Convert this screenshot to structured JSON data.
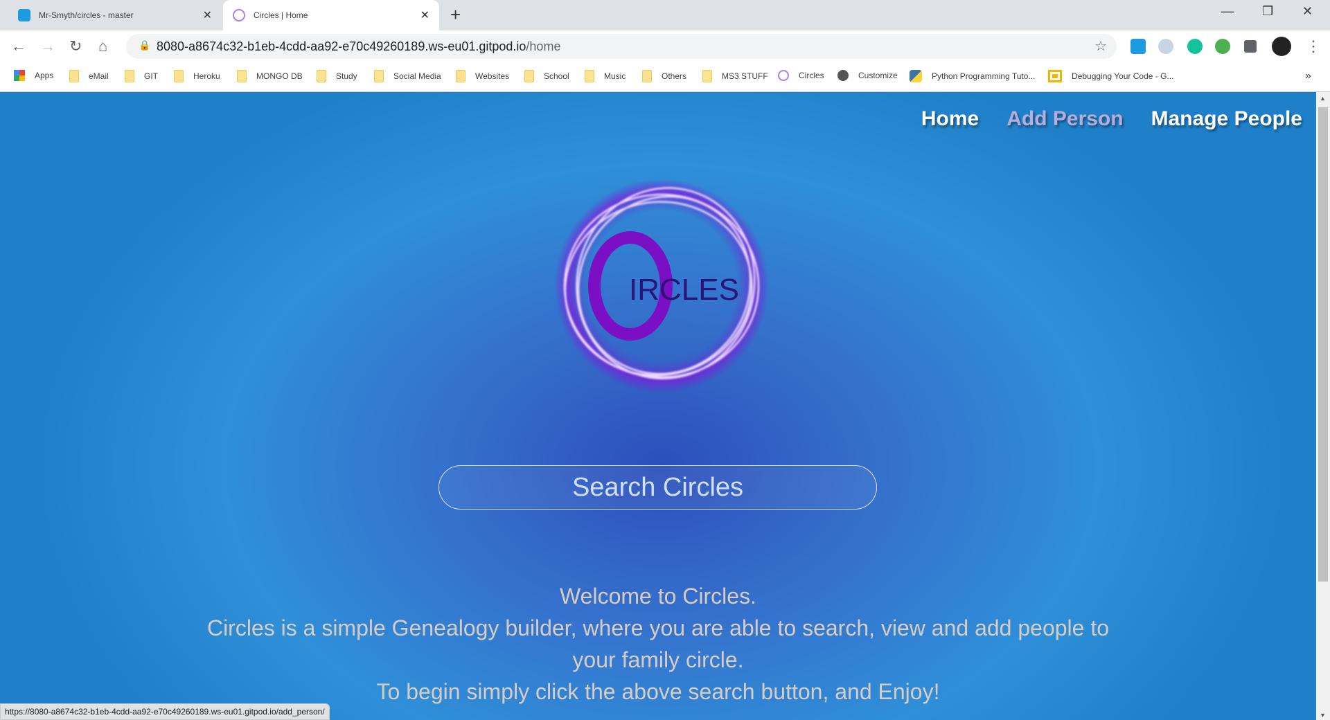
{
  "browser": {
    "tabs": [
      {
        "title": "Mr-Smyth/circles - master",
        "icon": "gitpod-icon"
      },
      {
        "title": "Circles | Home",
        "icon": "circles-icon",
        "active": true
      }
    ],
    "url_host": "8080-a8674c32-b1eb-4cdd-aa92-e70c49260189.ws-eu01.gitpod.io",
    "url_path": "/home",
    "bookmarks": [
      "Apps",
      "eMail",
      "GIT",
      "Heroku",
      "MONGO DB",
      "Study",
      "Social Media",
      "Websites",
      "School",
      "Music",
      "Others",
      "MS3 STUFF",
      "Circles",
      "Customize",
      "Python Programming Tuto...",
      "Debugging Your Code - G..."
    ],
    "more": "»",
    "status_url": "https://8080-a8674c32-b1eb-4cdd-aa92-e70c49260189.ws-eu01.gitpod.io/add_person/"
  },
  "nav": {
    "home": "Home",
    "add_person": "Add Person",
    "manage_people": "Manage People"
  },
  "logo": {
    "text": "IRCLES",
    "accent": "#7b0fc4"
  },
  "search": {
    "label": "Search Circles"
  },
  "welcome": {
    "line1": "Welcome to Circles.",
    "line2": "Circles is a simple Genealogy builder, where you are able to search, view and add people to",
    "line3": "your family circle.",
    "line4": "To begin simply click the above search button, and Enjoy!"
  }
}
